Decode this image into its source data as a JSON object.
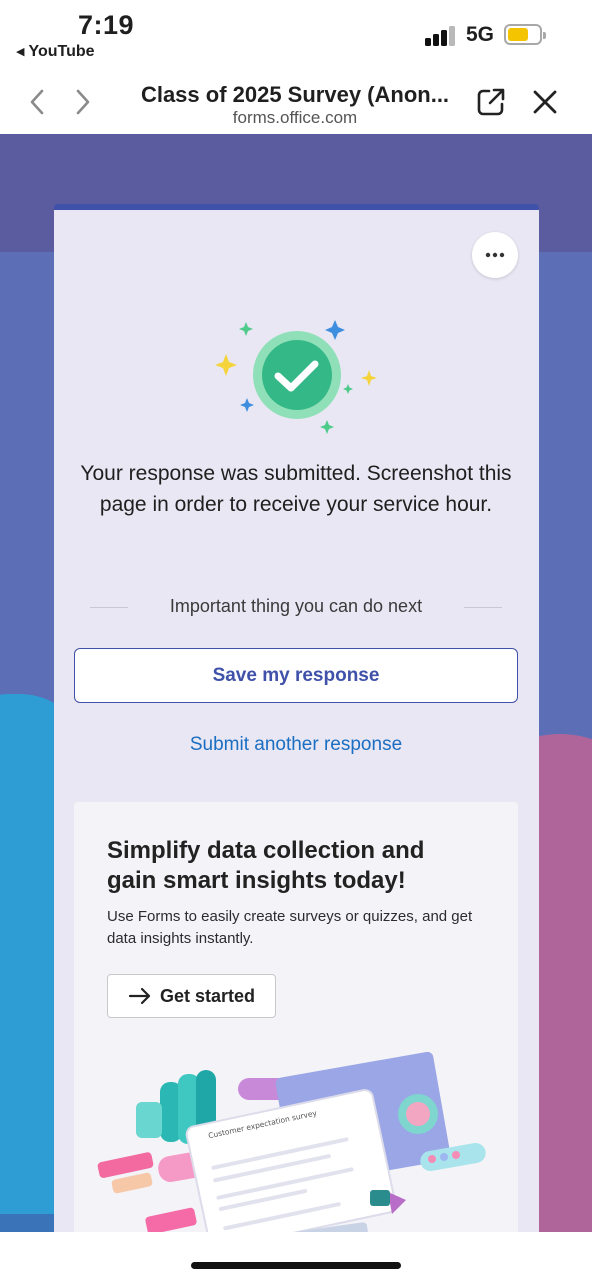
{
  "status_bar": {
    "time": "7:19",
    "back_app": "YouTube",
    "network": "5G",
    "battery_color": "#f5c400"
  },
  "browser": {
    "title": "Class of 2025 Survey (Anon...",
    "url": "forms.office.com",
    "icons": [
      "chevron-left-icon",
      "chevron-right-icon",
      "external-link-icon",
      "close-icon"
    ]
  },
  "form": {
    "accent_color": "#3f51a8",
    "link_color": "#1b6ec2",
    "message": "Your response was submitted. Screenshot this page in order to receive your service hour.",
    "next_label": "Important thing you can do next",
    "save_button": "Save my response",
    "another_link": "Submit another response"
  },
  "promo": {
    "heading": "Simplify data collection and gain smart insights today!",
    "text": "Use Forms to easily create surveys or quizzes, and get data insights instantly.",
    "cta": "Get started",
    "illustration_title": "Customer expectation survey"
  }
}
